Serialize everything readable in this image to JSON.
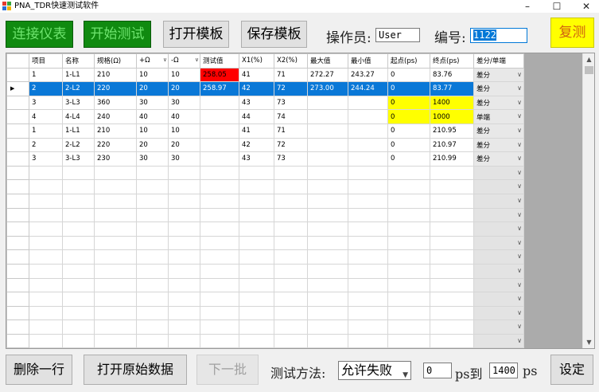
{
  "window": {
    "title": "PNA_TDR快速测试软件"
  },
  "toolbar": {
    "connect_label": "连接仪表",
    "start_label": "开始测试",
    "open_template_label": "打开模板",
    "save_template_label": "保存模板",
    "operator_label": "操作员:",
    "operator_value": "User",
    "number_label": "编号:",
    "number_value": "1122",
    "retest_label": "复测"
  },
  "grid": {
    "columns": [
      "项目",
      "名称",
      "规格(Ω)",
      "+Ω",
      "-Ω",
      "测试值",
      "X1(%)",
      "X2(%)",
      "最大值",
      "最小值",
      "起点(ps)",
      "终点(ps)",
      "差分/单端"
    ],
    "rows": [
      [
        "1",
        "1-L1",
        "210",
        "10",
        "10",
        "258.05",
        "41",
        "71",
        "272.27",
        "243.27",
        "0",
        "83.76",
        "差分"
      ],
      [
        "2",
        "2-L2",
        "220",
        "20",
        "20",
        "258.97",
        "42",
        "72",
        "273.00",
        "244.24",
        "0",
        "83.77",
        "差分"
      ],
      [
        "3",
        "3-L3",
        "360",
        "30",
        "30",
        "",
        "43",
        "73",
        "",
        "",
        "0",
        "1400",
        "差分"
      ],
      [
        "4",
        "4-L4",
        "240",
        "40",
        "40",
        "",
        "44",
        "74",
        "",
        "",
        "0",
        "1000",
        "单端"
      ],
      [
        "1",
        "1-L1",
        "210",
        "10",
        "10",
        "",
        "41",
        "71",
        "",
        "",
        "0",
        "210.95",
        "差分"
      ],
      [
        "2",
        "2-L2",
        "220",
        "20",
        "20",
        "",
        "42",
        "72",
        "",
        "",
        "0",
        "210.97",
        "差分"
      ],
      [
        "3",
        "3-L3",
        "230",
        "30",
        "30",
        "",
        "43",
        "73",
        "",
        "",
        "0",
        "210.99",
        "差分"
      ]
    ],
    "selected_row": 1,
    "colors": {
      "selection": "#0a78d7",
      "fail": "#ff0000",
      "highlight": "#ffff00"
    }
  },
  "bottom": {
    "delete_row_label": "删除一行",
    "open_raw_label": "打开原始数据",
    "next_batch_label": "下一批",
    "method_label": "测试方法:",
    "method_value": "允许失败",
    "range_start": "0",
    "range_mid_label": "ps到",
    "range_end": "1400",
    "range_unit": "ps",
    "settings_label": "设定"
  }
}
